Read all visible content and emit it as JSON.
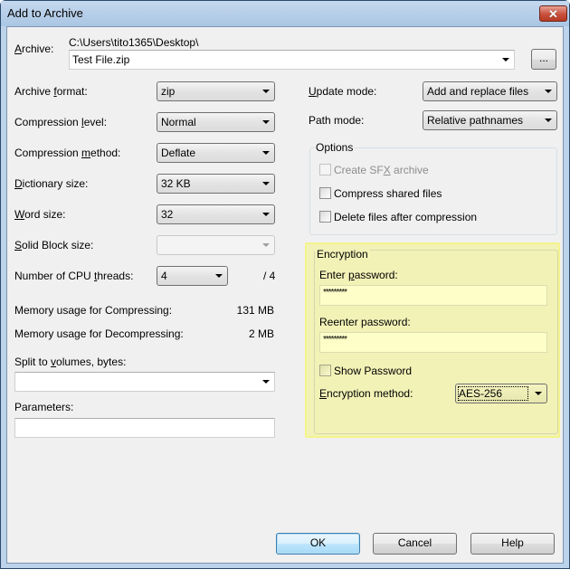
{
  "window": {
    "title": "Add to Archive",
    "close_label": "✕"
  },
  "archive": {
    "label_prefix": "",
    "label_ul": "A",
    "label_rest": "rchive:",
    "path": "C:\\Users\\tito1365\\Desktop\\",
    "filename": "Test File.zip",
    "browse_label": "..."
  },
  "left": {
    "archive_format": {
      "label_pre": "Archive ",
      "label_ul": "f",
      "label_post": "ormat:",
      "value": "zip"
    },
    "compression_level": {
      "label_pre": "Compression ",
      "label_ul": "l",
      "label_post": "evel:",
      "value": "Normal"
    },
    "compression_method": {
      "label_pre": "Compression ",
      "label_ul": "m",
      "label_post": "ethod:",
      "value": "Deflate"
    },
    "dictionary_size": {
      "label_pre": "",
      "label_ul": "D",
      "label_post": "ictionary size:",
      "value": "32 KB"
    },
    "word_size": {
      "label_pre": "",
      "label_ul": "W",
      "label_post": "ord size:",
      "value": "32"
    },
    "solid_block_size": {
      "label_pre": "",
      "label_ul": "S",
      "label_post": "olid Block size:",
      "value": ""
    },
    "cpu_threads": {
      "label_pre": "Number of CPU ",
      "label_ul": "t",
      "label_post": "hreads:",
      "value": "4",
      "max": "/ 4"
    },
    "memory_compress": {
      "label": "Memory usage for Compressing:",
      "value": "131 MB"
    },
    "memory_decompress": {
      "label": "Memory usage for Decompressing:",
      "value": "2 MB"
    },
    "split_volumes": {
      "label_pre": "Split to ",
      "label_ul": "v",
      "label_post": "olumes, bytes:",
      "value": ""
    },
    "parameters": {
      "label": "Parameters:",
      "value": ""
    }
  },
  "right": {
    "update_mode": {
      "label_pre": "",
      "label_ul": "U",
      "label_post": "pdate mode:",
      "value": "Add and replace files"
    },
    "path_mode": {
      "label": "Path mode:",
      "value": "Relative pathnames"
    },
    "options": {
      "title": "Options",
      "create_sfx": {
        "label_pre": "Create SF",
        "label_ul": "X",
        "label_post": " archive",
        "checked": false,
        "disabled": true
      },
      "compress_shared": {
        "label": "Compress shared files",
        "checked": false
      },
      "delete_after": {
        "label": "Delete files after compression",
        "checked": false
      }
    },
    "encryption": {
      "title": "Encryption",
      "enter_password": {
        "label_pre": "Enter ",
        "label_ul": "p",
        "label_post": "assword:",
        "value": "*********"
      },
      "reenter_password": {
        "label": "Reenter password:",
        "value": "*********"
      },
      "show_password": {
        "label": "Show Password",
        "checked": false
      },
      "method": {
        "label_pre": "",
        "label_ul": "E",
        "label_post": "ncryption method:",
        "value": "AES-256"
      },
      "highlight_color": "#f2f2b7"
    }
  },
  "buttons": {
    "ok": "OK",
    "cancel": "Cancel",
    "help": "Help"
  }
}
